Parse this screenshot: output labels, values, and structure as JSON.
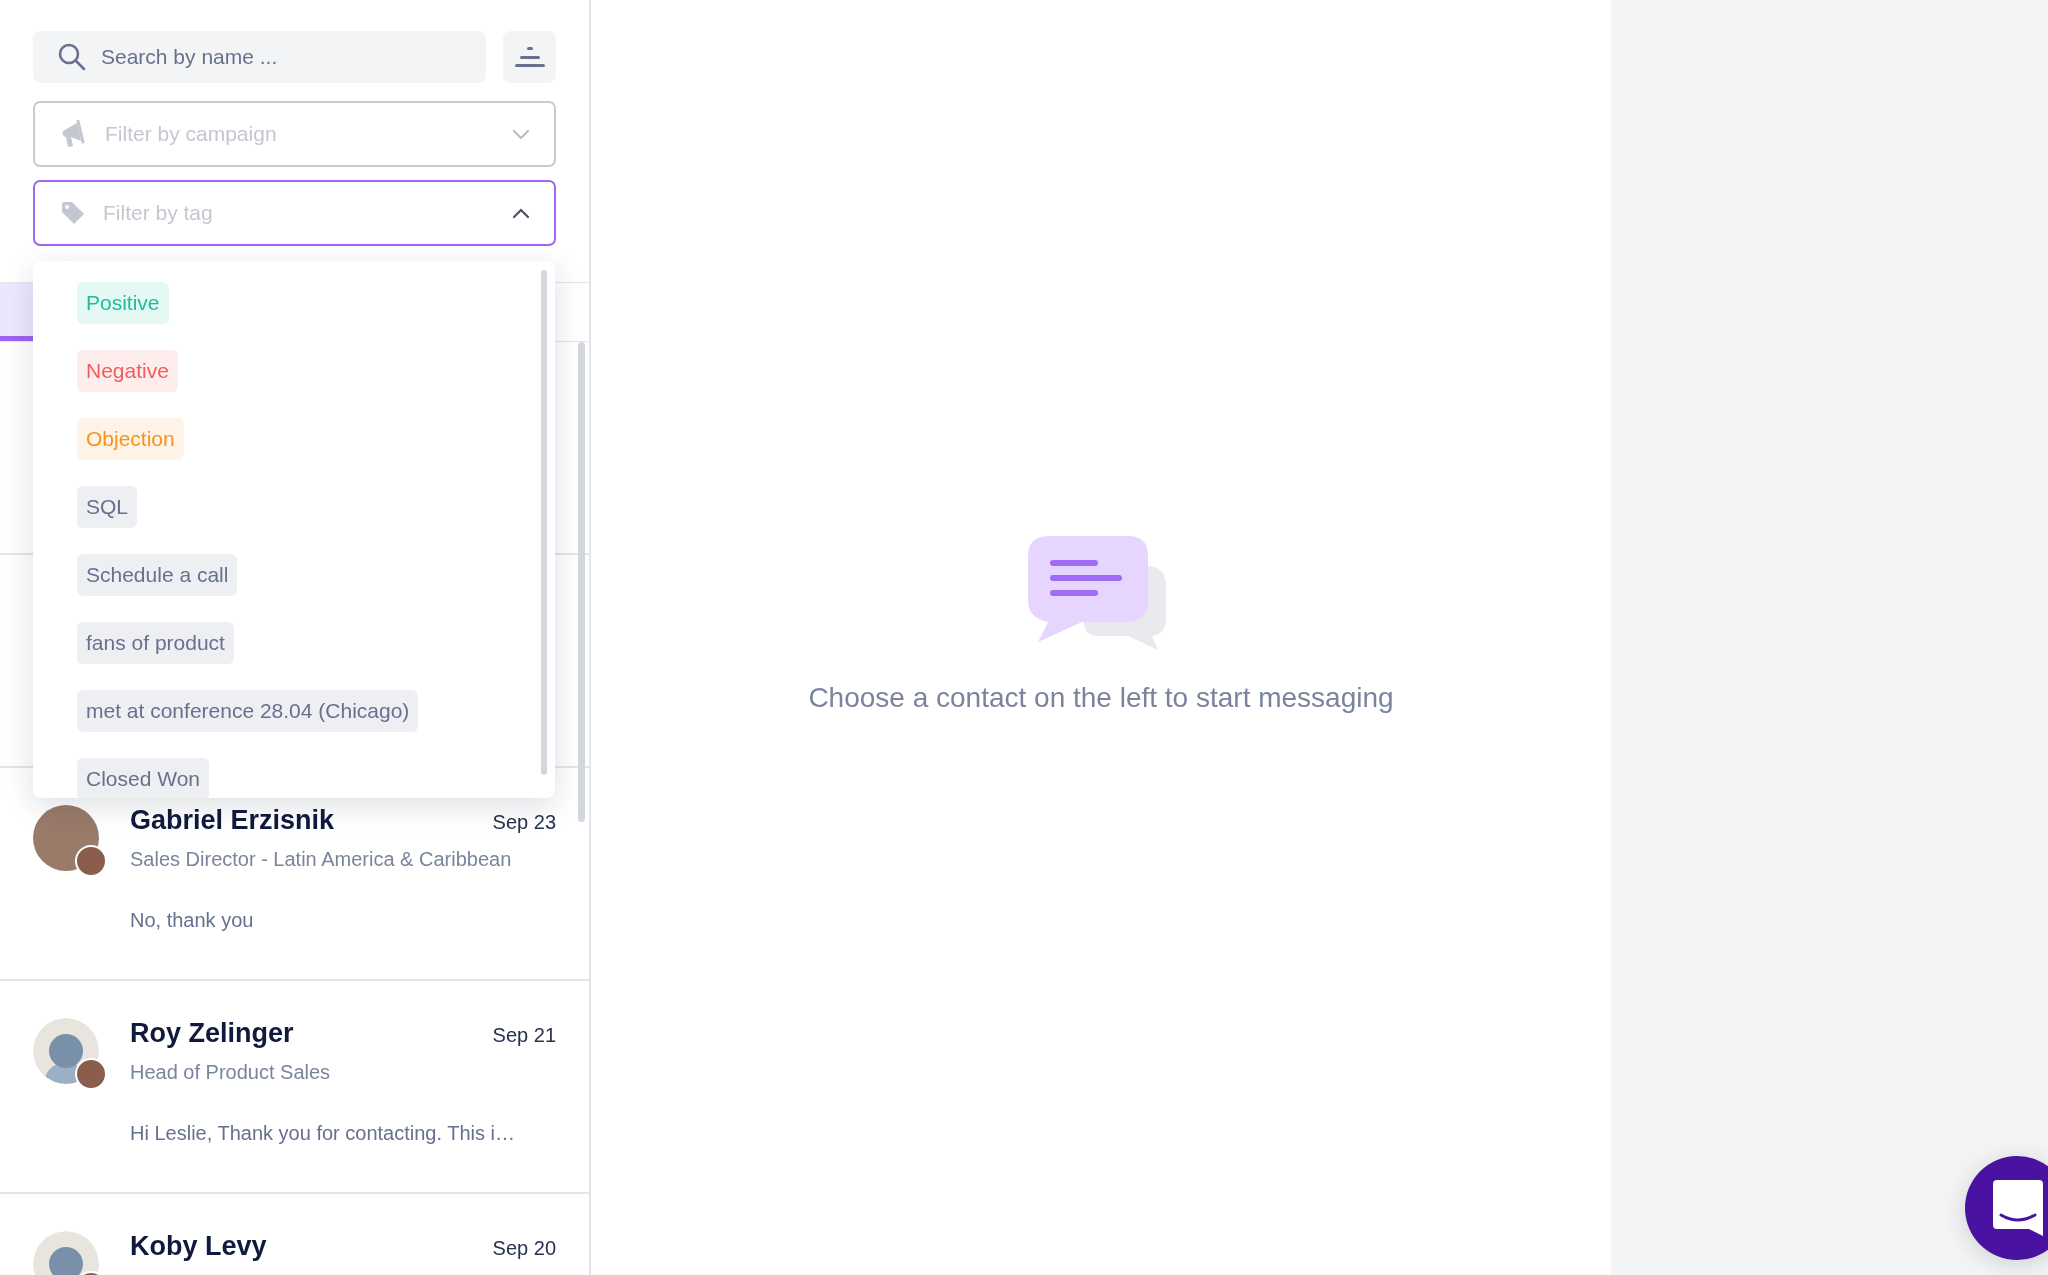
{
  "search": {
    "placeholder": "Search by name ..."
  },
  "campaign_filter": {
    "placeholder": "Filter by campaign",
    "expanded": false
  },
  "tag_filter": {
    "placeholder": "Filter by tag",
    "expanded": true
  },
  "tag_options": [
    {
      "label": "Positive",
      "color": "#1cbf9b"
    },
    {
      "label": "Negative",
      "color": "#f25c5c"
    },
    {
      "label": "Objection",
      "color": "#f7931e"
    },
    {
      "label": "SQL",
      "color": "#67718f"
    },
    {
      "label": "Schedule a call",
      "color": "#67718f"
    },
    {
      "label": "fans of product",
      "color": "#67718f"
    },
    {
      "label": "met at conference 28.04 (Chicago)",
      "color": "#67718f"
    },
    {
      "label": "Closed Won",
      "color": "#67718f"
    }
  ],
  "contacts": [
    {
      "name": "Gabriel Erzisnik",
      "date": "Sep 23",
      "title": "Sales Director - Latin America & Caribbean",
      "message": "No, thank you",
      "kind": "photo"
    },
    {
      "name": "Roy Zelinger",
      "date": "Sep 21",
      "title": "Head of Product Sales",
      "message": "Hi Leslie, Thank you for contacting. This i…",
      "kind": "default"
    },
    {
      "name": "Koby Levy",
      "date": "Sep 20",
      "kind": "default"
    }
  ],
  "empty_state": {
    "message": "Choose a contact on the left to start messaging"
  }
}
